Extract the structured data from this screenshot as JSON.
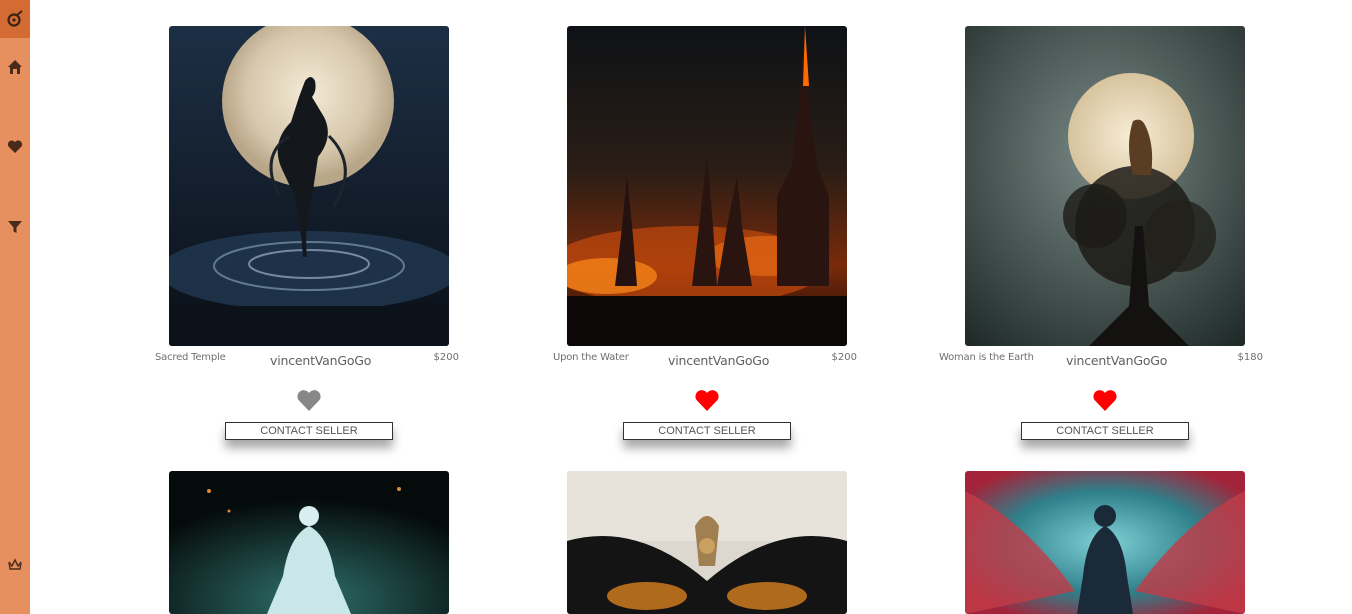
{
  "sidebar": {
    "items": [
      {
        "icon": "logo-icon"
      },
      {
        "icon": "home-icon"
      },
      {
        "icon": "heart-icon"
      },
      {
        "icon": "filter-icon"
      },
      {
        "icon": "crown-icon"
      }
    ]
  },
  "cards": [
    {
      "title": "Sacred Temple",
      "artist": "vincentVanGoGo",
      "price": "$200",
      "liked": false,
      "button": "CONTACT SELLER"
    },
    {
      "title": "Upon the Water",
      "artist": "vincentVanGoGo",
      "price": "$200",
      "liked": true,
      "button": "CONTACT SELLER"
    },
    {
      "title": "Woman is the Earth",
      "artist": "vincentVanGoGo",
      "price": "$180",
      "liked": true,
      "button": "CONTACT SELLER"
    },
    {
      "title": "",
      "artist": "",
      "price": "",
      "liked": false,
      "button": ""
    },
    {
      "title": "",
      "artist": "",
      "price": "",
      "liked": false,
      "button": ""
    },
    {
      "title": "",
      "artist": "",
      "price": "",
      "liked": false,
      "button": ""
    }
  ],
  "colors": {
    "sidebar": "#e68f5f",
    "sidebar_logo": "#d46b32",
    "icon_dark": "#4a2a1a",
    "heart_liked": "#ff0000",
    "heart_unliked": "#888888"
  }
}
